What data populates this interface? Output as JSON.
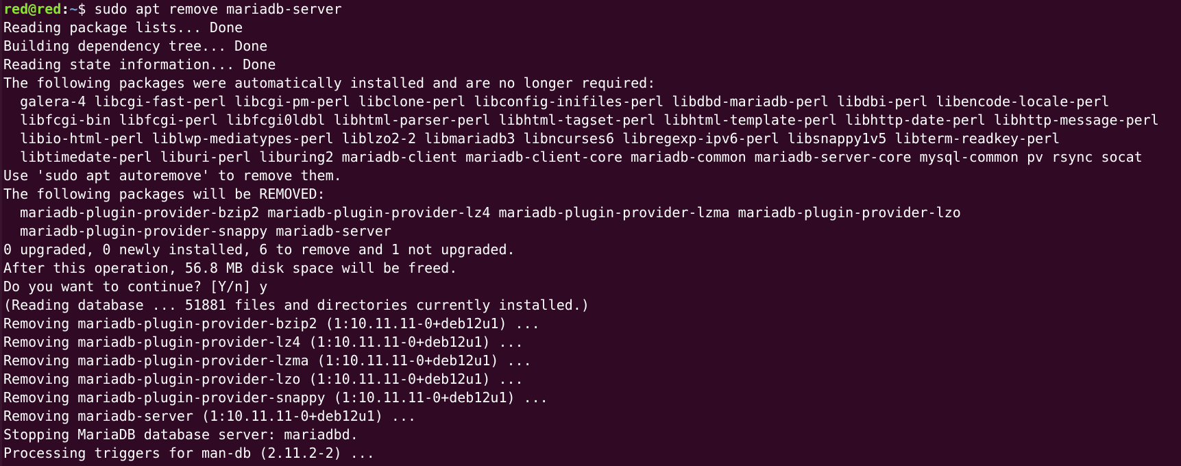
{
  "terminal": {
    "prompt": {
      "user_host": "red@red",
      "separator": ":",
      "path": "~",
      "symbol": "$ ",
      "command": "sudo apt remove mariadb-server"
    },
    "output": [
      "Reading package lists... Done",
      "Building dependency tree... Done",
      "Reading state information... Done",
      "The following packages were automatically installed and are no longer required:",
      "  galera-4 libcgi-fast-perl libcgi-pm-perl libclone-perl libconfig-inifiles-perl libdbd-mariadb-perl libdbi-perl libencode-locale-perl",
      "  libfcgi-bin libfcgi-perl libfcgi0ldbl libhtml-parser-perl libhtml-tagset-perl libhtml-template-perl libhttp-date-perl libhttp-message-perl",
      "  libio-html-perl liblwp-mediatypes-perl liblzo2-2 libmariadb3 libncurses6 libregexp-ipv6-perl libsnappy1v5 libterm-readkey-perl",
      "  libtimedate-perl liburi-perl liburing2 mariadb-client mariadb-client-core mariadb-common mariadb-server-core mysql-common pv rsync socat",
      "Use 'sudo apt autoremove' to remove them.",
      "The following packages will be REMOVED:",
      "  mariadb-plugin-provider-bzip2 mariadb-plugin-provider-lz4 mariadb-plugin-provider-lzma mariadb-plugin-provider-lzo",
      "  mariadb-plugin-provider-snappy mariadb-server",
      "0 upgraded, 0 newly installed, 6 to remove and 1 not upgraded.",
      "After this operation, 56.8 MB disk space will be freed.",
      "Do you want to continue? [Y/n] y",
      "(Reading database ... 51881 files and directories currently installed.)",
      "Removing mariadb-plugin-provider-bzip2 (1:10.11.11-0+deb12u1) ...",
      "Removing mariadb-plugin-provider-lz4 (1:10.11.11-0+deb12u1) ...",
      "Removing mariadb-plugin-provider-lzma (1:10.11.11-0+deb12u1) ...",
      "Removing mariadb-plugin-provider-lzo (1:10.11.11-0+deb12u1) ...",
      "Removing mariadb-plugin-provider-snappy (1:10.11.11-0+deb12u1) ...",
      "Removing mariadb-server (1:10.11.11-0+deb12u1) ...",
      "Stopping MariaDB database server: mariadbd.",
      "Processing triggers for man-db (2.11.2-2) ..."
    ],
    "colors": {
      "background": "#300a24",
      "text": "#ffffff",
      "prompt_user": "#8ae234",
      "prompt_path": "#729fcf"
    }
  }
}
